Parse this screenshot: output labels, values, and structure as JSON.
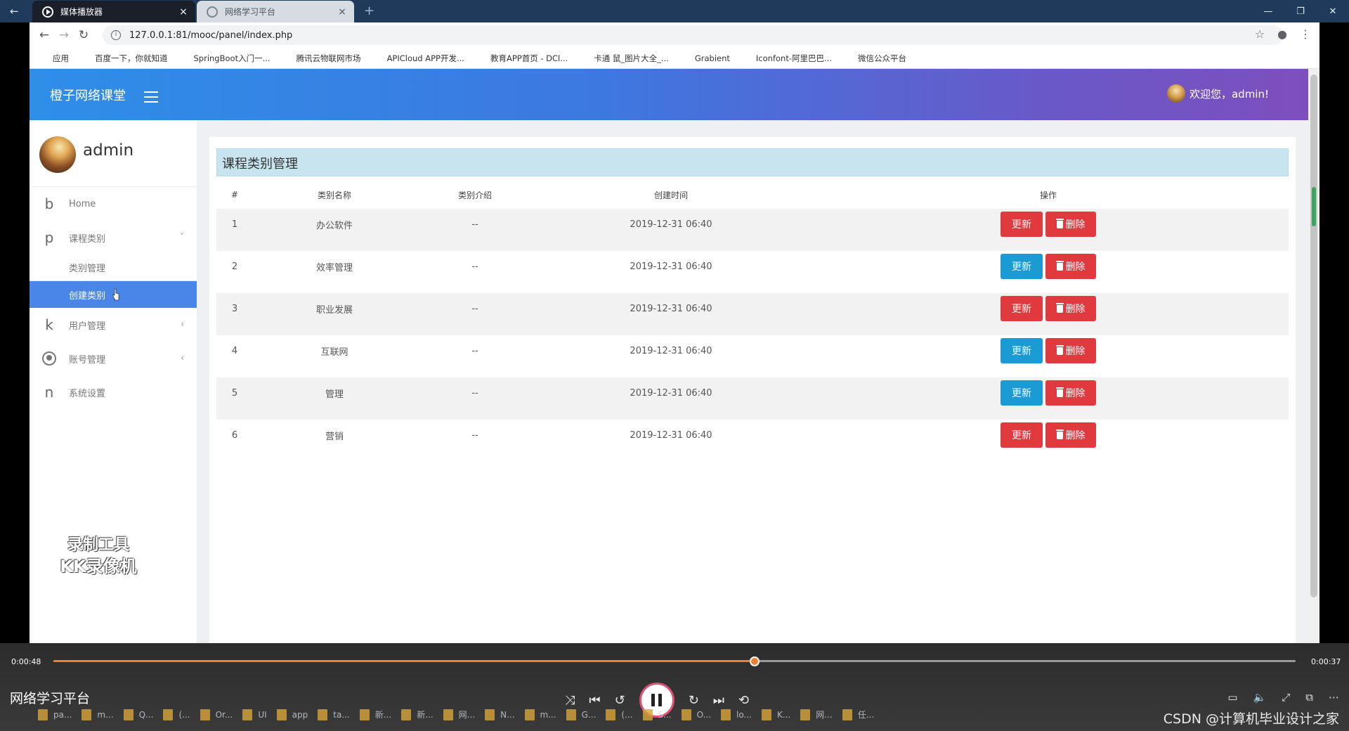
{
  "browser": {
    "tabs": [
      {
        "title": "媒体播放器",
        "active": true
      },
      {
        "title": "网络学习平台",
        "active": false
      }
    ],
    "url": "127.0.0.1:81/mooc/panel/index.php",
    "bookmarks": [
      {
        "label": "应用",
        "color": "#4285f4"
      },
      {
        "label": "百度一下，你就知道",
        "color": "#2d66de"
      },
      {
        "label": "SpringBoot入门一...",
        "color": "#2a5bd7"
      },
      {
        "label": "腾讯云物联网市场",
        "color": "#00a3ff"
      },
      {
        "label": "APICloud APP开发...",
        "color": "#7a9a20"
      },
      {
        "label": "教育APP首页 - DCl...",
        "color": "#f36f24"
      },
      {
        "label": "卡通 鼠_图片大全_...",
        "color": "#ff9900"
      },
      {
        "label": "Grabient",
        "color": "#c6a0ff"
      },
      {
        "label": "Iconfont-阿里巴巴...",
        "color": "#e0322f"
      },
      {
        "label": "微信公众平台",
        "color": "#3eb34a"
      }
    ]
  },
  "header": {
    "brand": "橙子网络课堂",
    "welcome": "欢迎您，admin!"
  },
  "profile": {
    "name": "admin"
  },
  "nav": {
    "home": {
      "glyph": "b",
      "label": "Home"
    },
    "course_category": {
      "glyph": "p",
      "label": "课程类别",
      "caret": "˅"
    },
    "sub_manage": "类别管理",
    "sub_create": "创建类别",
    "user_mgmt": {
      "glyph": "k",
      "label": "用户管理",
      "caret": "‹"
    },
    "account_mgmt": {
      "label": "账号管理",
      "caret": "‹"
    },
    "system": {
      "glyph": "n",
      "label": "系统设置"
    }
  },
  "watermark": {
    "line1": "录制工具",
    "line2": "KK录像机"
  },
  "panel": {
    "title": "课程类别管理"
  },
  "table": {
    "headers": [
      "#",
      "类别名称",
      "类别介绍",
      "创建时间",
      "操作"
    ],
    "update_label": "更新",
    "delete_label": "删除",
    "rows": [
      {
        "id": "1",
        "name": "办公软件",
        "intro": "--",
        "created": "2019-12-31 06:40",
        "update_color": "#e0393e"
      },
      {
        "id": "2",
        "name": "效率管理",
        "intro": "--",
        "created": "2019-12-31 06:40",
        "update_color": "#1a9bd4"
      },
      {
        "id": "3",
        "name": "职业发展",
        "intro": "--",
        "created": "2019-12-31 06:40",
        "update_color": "#e0393e"
      },
      {
        "id": "4",
        "name": "互联网",
        "intro": "--",
        "created": "2019-12-31 06:40",
        "update_color": "#1a9bd4"
      },
      {
        "id": "5",
        "name": "管理",
        "intro": "--",
        "created": "2019-12-31 06:40",
        "update_color": "#1a9bd4"
      },
      {
        "id": "6",
        "name": "营销",
        "intro": "--",
        "created": "2019-12-31 06:40",
        "update_color": "#e0393e"
      }
    ]
  },
  "player": {
    "elapsed": "0:00:48",
    "remaining": "0:00:37",
    "progress": 0.5646,
    "title": "网络学习平台",
    "accent": "#f07f2d"
  },
  "taskbar": {
    "items": [
      "pa...",
      "m...",
      "Q...",
      "(...",
      "Or...",
      "UI",
      "app",
      "ta...",
      "新...",
      "新...",
      "网...",
      "N...",
      "m...",
      "G...",
      "(...",
      "S...",
      "O...",
      "lo...",
      "K...",
      "网...",
      "任..."
    ],
    "watermark": "CSDN @计算机毕业设计之家"
  }
}
